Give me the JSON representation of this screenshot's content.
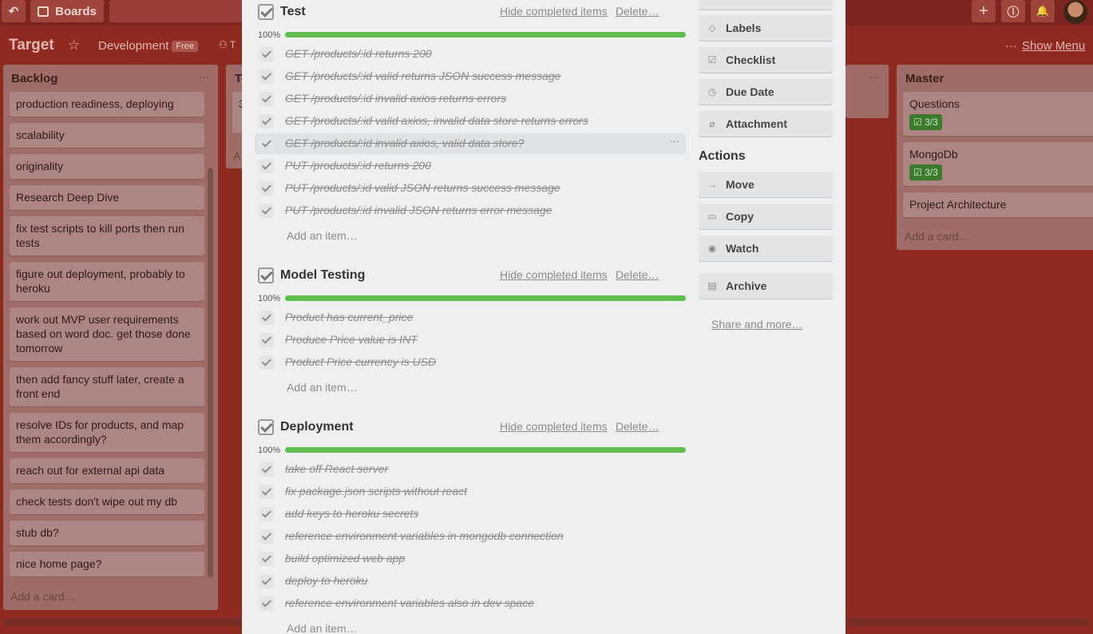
{
  "topbar": {
    "back_glyph": "↶",
    "boards_label": "Boards",
    "add_glyph": "+",
    "info_glyph": "ⓘ",
    "bell_glyph": "🔔"
  },
  "board": {
    "title": "Target",
    "star_glyph": "☆",
    "team": "Development",
    "team_badge": "Free",
    "show_menu_dots": "···",
    "show_menu": "Show Menu"
  },
  "lists": {
    "backlog": {
      "title": "Backlog",
      "dots": "···",
      "cards": [
        "production readiness, deploying",
        "scalability",
        "originality",
        "Research Deep Dive",
        "fix test scripts to kill ports then run tests",
        "figure out deployment, probably to heroku",
        "work out MVP user requirements based on word doc. get those done tomorrow",
        "then add fancy stuff later, create a front end",
        "resolve IDs for products, and map them accordingly?",
        "reach out for external api data",
        "check tests don't wipe out my db",
        "stub db?",
        "nice home page?"
      ],
      "add_card": "Add a card…"
    },
    "second": {
      "title_fragment": "To",
      "card_fragment": "3",
      "add_fragment": "A"
    },
    "hidden_dots": "···",
    "master": {
      "title": "Master",
      "cards": [
        {
          "title": "Questions",
          "badge": "☑ 3/3"
        },
        {
          "title": "MongoDb",
          "badge": "☑ 3/3"
        },
        {
          "title": "Project Architecture",
          "badge": ""
        }
      ],
      "add_card": "Add a card…"
    }
  },
  "modal": {
    "hide_completed": "Hide completed items",
    "delete": "Delete…",
    "add_item": "Add an item…",
    "checklists": [
      {
        "title": "Test",
        "percent": "100%",
        "progress": 1.0,
        "items": [
          "GET /products/:id returns 200",
          "GET /products/:id valid returns JSON success message",
          "GET /products/:id invalid axios returns errors",
          "GET /products/:id valid axios, invalid data store returns errors",
          "GET /products/:id invalid axios, valid data store?",
          "PUT /products/:id returns 200",
          "PUT /products/:id valid JSON returns success message",
          "PUT /products/:id invalid JSON returns error message"
        ]
      },
      {
        "title": "Model Testing",
        "percent": "100%",
        "progress": 1.0,
        "items": [
          "Product has current_price",
          "Produce Price value is INT",
          "Product Price currency is USD"
        ]
      },
      {
        "title": "Deployment",
        "percent": "100%",
        "progress": 1.0,
        "items": [
          "take off React server",
          "fix package.json scripts without react",
          "add keys to heroku secrets",
          "reference environment variables in mongodb connection",
          "build optimized web app",
          "deploy to heroku",
          "reference environment variables also in dev space"
        ]
      }
    ],
    "item_dots": "···",
    "sidebar": {
      "add_buttons": [
        {
          "label": "Labels",
          "icon": "tag-icon",
          "glyph": "◇"
        },
        {
          "label": "Checklist",
          "icon": "checklist-icon",
          "glyph": "☑"
        },
        {
          "label": "Due Date",
          "icon": "clock-icon",
          "glyph": "◷"
        },
        {
          "label": "Attachment",
          "icon": "paperclip-icon",
          "glyph": "⌀"
        }
      ],
      "actions_heading": "Actions",
      "action_buttons": [
        {
          "label": "Move",
          "icon": "arrow-right-icon",
          "glyph": "→"
        },
        {
          "label": "Copy",
          "icon": "copy-icon",
          "glyph": "▭"
        },
        {
          "label": "Watch",
          "icon": "eye-icon",
          "glyph": "◉"
        },
        {
          "label": "Archive",
          "icon": "archive-icon",
          "glyph": "▤"
        }
      ],
      "share": "Share and more…"
    }
  },
  "colors": {
    "board_bg": "#8f2a21",
    "modal_bg": "#edeff0",
    "progress_green": "#61bd4f"
  }
}
